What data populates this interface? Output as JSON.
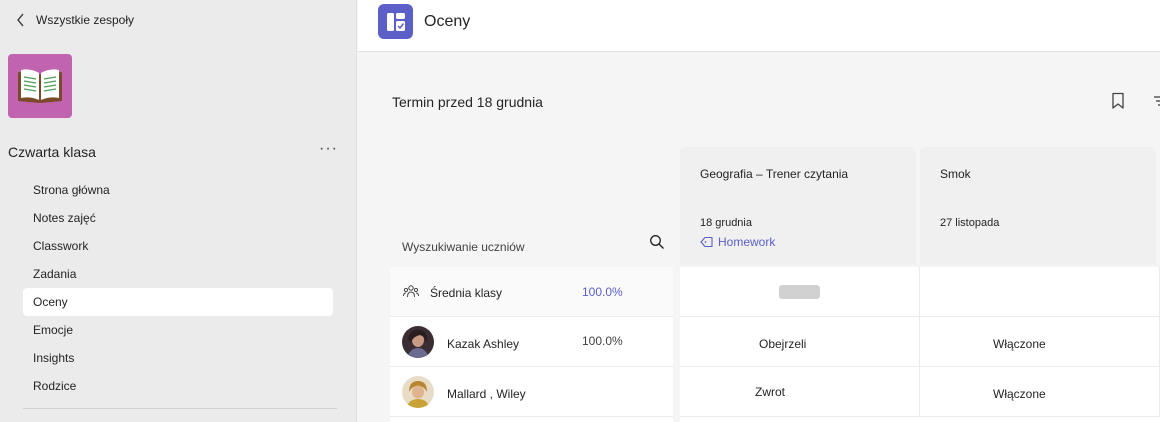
{
  "sidebar": {
    "back_label": "Wszystkie zespoły",
    "team_name": "Czwarta klasa",
    "more_label": "···",
    "nav": [
      {
        "label": "Strona główna"
      },
      {
        "label": "Notes zajęć"
      },
      {
        "label": "Classwork"
      },
      {
        "label": "Zadania"
      },
      {
        "label": "Oceny"
      },
      {
        "label": "Emocje"
      },
      {
        "label": "Insights"
      },
      {
        "label": "Rodzice"
      }
    ],
    "active_item": "Oceny"
  },
  "header": {
    "title": "Oceny"
  },
  "content": {
    "filter_title": "Termin przed 18 grudnia",
    "search_label": "Wyszukiwanie uczniów",
    "assignments": [
      {
        "title": "Geografia – Trener czytania",
        "date": "18 grudnia",
        "tag": "Homework"
      },
      {
        "title": "Smok",
        "date": "27 listopada",
        "tag": ""
      }
    ],
    "class_average": {
      "label": "Średnia klasy",
      "value": "100.0%"
    },
    "students": [
      {
        "name": "Kazak Ashley",
        "score": "100.0%",
        "grades": [
          "Obejrzeli",
          "Włączone"
        ]
      },
      {
        "name": "Mallard , Wiley",
        "score": "",
        "grades": [
          "Zwrot",
          "Włączone"
        ]
      }
    ]
  },
  "colors": {
    "accent": "#5b5fc7",
    "team_tile": "#c064b0",
    "sidebar_bg": "#ebebeb"
  },
  "icons": [
    "chevron-left-icon",
    "book-icon",
    "more-icon",
    "grades-app-icon",
    "bookmark-icon",
    "filter-icon",
    "search-icon",
    "tag-icon",
    "people-icon"
  ]
}
